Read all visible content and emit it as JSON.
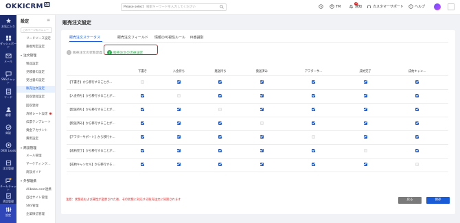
{
  "header": {
    "logo": "OKKICRM",
    "logo_badge": "AI",
    "search_scope": "Please select",
    "search_placeholder": "検索キーワードを入力してください",
    "user": "TM",
    "notifications_label": "通知",
    "notifications_count": "6",
    "support_label": "カスタマーサポート",
    "help_label": "ヘルプ"
  },
  "iconbar": [
    {
      "label": "お気に入り",
      "icon": "star-icon",
      "active": false
    },
    {
      "label": "ダッシュボード",
      "icon": "dashboard-icon",
      "active": false
    },
    {
      "label": "メール",
      "icon": "mail-icon",
      "active": false
    },
    {
      "label": "SNSチャット",
      "icon": "chat-icon",
      "active": false
    },
    {
      "label": "リード",
      "icon": "lead-icon",
      "active": false
    },
    {
      "label": "顧客",
      "icon": "customer-icon",
      "active": false
    },
    {
      "label": "商談",
      "icon": "deal-icon",
      "active": false
    },
    {
      "label": "OKKI Leads",
      "icon": "leads-icon",
      "active": false
    },
    {
      "label": "注文管理",
      "icon": "order-icon",
      "active": false
    },
    {
      "label": "チームチャット",
      "icon": "team-chat-icon",
      "active": false
    },
    {
      "label": "承認管理",
      "icon": "approval-icon",
      "active": false
    },
    {
      "label": "設定",
      "icon": "settings-icon",
      "active": true
    }
  ],
  "submenu": {
    "title": "設定",
    "search_placeholder": "このページのメニュー",
    "entries": [
      {
        "type": "item",
        "label": "リードソース設定"
      },
      {
        "type": "item",
        "label": "重複判定設定"
      },
      {
        "type": "group",
        "label": "注文管理"
      },
      {
        "type": "item",
        "label": "製品設定"
      },
      {
        "type": "item",
        "label": "見積書の設定"
      },
      {
        "type": "item",
        "label": "受注書の設定"
      },
      {
        "type": "item",
        "label": "販売注文設定",
        "active": true
      },
      {
        "type": "item",
        "label": "回収登録設定"
      },
      {
        "type": "item",
        "label": "回収登録"
      },
      {
        "type": "item",
        "label": "為替レート設定",
        "dot": true
      },
      {
        "type": "item",
        "label": "伝票テンプレート"
      },
      {
        "type": "item",
        "label": "資金アカウント"
      },
      {
        "type": "item",
        "label": "費用設定"
      },
      {
        "type": "group",
        "label": "商談管理"
      },
      {
        "type": "item",
        "label": "メール管理"
      },
      {
        "type": "item",
        "label": "マーケティング…"
      },
      {
        "type": "item",
        "label": "商談ガイド"
      },
      {
        "type": "group",
        "label": "外部連携"
      },
      {
        "type": "item",
        "label": "Alibaba.com連携"
      },
      {
        "type": "item",
        "label": "自社サイト管理"
      },
      {
        "type": "item",
        "label": "SNS管理"
      },
      {
        "type": "item",
        "label": "企業微信管理"
      }
    ]
  },
  "main": {
    "page_title": "販売注文設定",
    "tabs": [
      "販売注文ステータス",
      "販売注文フィールド",
      "情報の可視性ルール",
      "PI番識別"
    ],
    "active_tab": 0,
    "steps": [
      {
        "num": "1",
        "label": "販売注文の状態定義"
      },
      {
        "num": "2",
        "label": "販売注文の流通設定"
      }
    ],
    "active_step": 1,
    "columns": [
      "下書き",
      "入金待ち",
      "発送待ち",
      "発送済み",
      "アフターサ…",
      "成約完了",
      "成約キャン…"
    ],
    "rows": [
      {
        "label": "【下書き】から移行することが…",
        "states": [
          "dis",
          "on",
          "on",
          "on",
          "on",
          "on",
          "on"
        ]
      },
      {
        "label": "【入金待ち】から移行することが…",
        "states": [
          "on",
          "dis",
          "on",
          "on",
          "on",
          "on",
          "on"
        ]
      },
      {
        "label": "【発送待ち】から移行することが…",
        "states": [
          "on",
          "on",
          "dis",
          "on",
          "on",
          "on",
          "on"
        ]
      },
      {
        "label": "【発送済み】から移行することが…",
        "states": [
          "on",
          "on",
          "on",
          "dis",
          "on",
          "on",
          "on"
        ]
      },
      {
        "label": "【アフターサポート】から移行す…",
        "states": [
          "on",
          "on",
          "on",
          "on",
          "dis",
          "on",
          "on"
        ]
      },
      {
        "label": "【成約完了】から移行することが…",
        "states": [
          "on",
          "on",
          "on",
          "on",
          "on",
          "dis",
          "on"
        ]
      },
      {
        "label": "【成約キャンセル】から移行する…",
        "states": [
          "on",
          "on",
          "on",
          "on",
          "on",
          "on",
          "dis"
        ]
      }
    ],
    "note": "注意：状態名および属性が変更された後、その状態に対応する販売注文に同期されます",
    "back_label": "戻る",
    "save_label": "保存"
  },
  "colors": {
    "accent": "#1a5cd8",
    "sidebar": "#1a2a6c",
    "step_active": "#2fa84f",
    "highlight_box": "#e02020"
  }
}
